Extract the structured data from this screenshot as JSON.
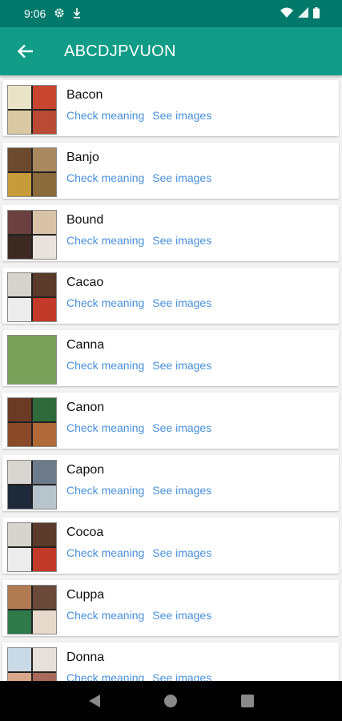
{
  "status": {
    "time": "9:06"
  },
  "header": {
    "title": "ABCDJPVUON",
    "back_icon": "arrow-left-icon"
  },
  "links": {
    "meaning": "Check meaning",
    "images": "See images"
  },
  "words": [
    {
      "word": "Bacon",
      "colors": [
        "#e9e4c8",
        "#c8462f",
        "#d8c9a4",
        "#b94a34"
      ]
    },
    {
      "word": "Banjo",
      "colors": [
        "#6b4a2e",
        "#a8885e",
        "#c79a3a",
        "#8b6a3c"
      ]
    },
    {
      "word": "Bound",
      "colors": [
        "#6b4040",
        "#d9c3a8",
        "#3c2a22",
        "#e8e3dc"
      ]
    },
    {
      "word": "Cacao",
      "colors": [
        "#d6d2cc",
        "#5a3a2a",
        "#ececec",
        "#c43a2a"
      ]
    },
    {
      "word": "Canna",
      "colors": [
        "#7aa25a"
      ]
    },
    {
      "word": "Canon",
      "colors": [
        "#6b3b26",
        "#2f6b3a",
        "#8a4a2a",
        "#b06a3a"
      ]
    },
    {
      "word": "Capon",
      "colors": [
        "#d9d6d2",
        "#6d7a8a",
        "#1e2a3a",
        "#b8c4cc"
      ]
    },
    {
      "word": "Cocoa",
      "colors": [
        "#d6d2cc",
        "#5a3a2a",
        "#ececec",
        "#c43a2a"
      ]
    },
    {
      "word": "Cuppa",
      "colors": [
        "#b07a52",
        "#6a4a3a",
        "#2f7a4a",
        "#e6d9cc"
      ]
    },
    {
      "word": "Donna",
      "colors": [
        "#c9d9e6",
        "#e6e0da",
        "#d9a88a",
        "#a86a5a"
      ]
    }
  ],
  "nav": {
    "back": "nav-back-icon",
    "home": "nav-home-icon",
    "recents": "nav-recents-icon"
  }
}
